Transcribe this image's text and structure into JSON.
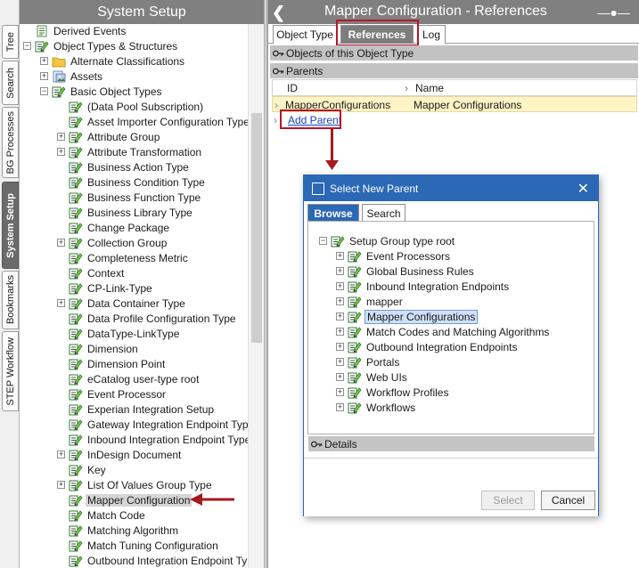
{
  "vertical_tabs": [
    "Tree",
    "Search",
    "BG Processes",
    "System Setup",
    "Bookmarks",
    "STEP Workflow"
  ],
  "left_panel": {
    "title": "System Setup",
    "tree": [
      {
        "label": "Derived Events",
        "expander": "none",
        "icon": "document-list-icon"
      },
      {
        "label": "Object Types & Structures",
        "expander": "minus",
        "icon": "object-type-icon"
      },
      {
        "label": "Alternate Classifications",
        "expander": "plus",
        "icon": "folder-icon"
      },
      {
        "label": "Assets",
        "expander": "plus",
        "icon": "asset-icon"
      },
      {
        "label": "Basic Object Types",
        "expander": "minus",
        "icon": "object-type-icon"
      },
      {
        "label": "(Data Pool Subscription)",
        "expander": "none",
        "icon": "object-type-icon"
      },
      {
        "label": "Asset Importer Configuration Type",
        "expander": "none",
        "icon": "object-type-icon"
      },
      {
        "label": "Attribute Group",
        "expander": "plus",
        "icon": "object-type-icon"
      },
      {
        "label": "Attribute Transformation",
        "expander": "plus",
        "icon": "object-type-icon"
      },
      {
        "label": "Business Action Type",
        "expander": "none",
        "icon": "object-type-icon"
      },
      {
        "label": "Business Condition Type",
        "expander": "none",
        "icon": "object-type-icon"
      },
      {
        "label": "Business Function Type",
        "expander": "none",
        "icon": "object-type-icon"
      },
      {
        "label": "Business Library Type",
        "expander": "none",
        "icon": "object-type-icon"
      },
      {
        "label": "Change Package",
        "expander": "none",
        "icon": "object-type-icon"
      },
      {
        "label": "Collection Group",
        "expander": "plus",
        "icon": "object-type-icon"
      },
      {
        "label": "Completeness Metric",
        "expander": "none",
        "icon": "object-type-icon"
      },
      {
        "label": "Context",
        "expander": "none",
        "icon": "object-type-icon"
      },
      {
        "label": "CP-Link-Type",
        "expander": "none",
        "icon": "object-type-icon"
      },
      {
        "label": "Data Container Type",
        "expander": "plus",
        "icon": "object-type-icon"
      },
      {
        "label": "Data Profile Configuration Type",
        "expander": "none",
        "icon": "object-type-icon"
      },
      {
        "label": "DataType-LinkType",
        "expander": "none",
        "icon": "object-type-icon"
      },
      {
        "label": "Dimension",
        "expander": "none",
        "icon": "object-type-icon"
      },
      {
        "label": "Dimension Point",
        "expander": "none",
        "icon": "object-type-icon"
      },
      {
        "label": "eCatalog user-type root",
        "expander": "none",
        "icon": "object-type-icon"
      },
      {
        "label": "Event Processor",
        "expander": "none",
        "icon": "object-type-icon"
      },
      {
        "label": "Experian Integration Setup",
        "expander": "none",
        "icon": "object-type-icon"
      },
      {
        "label": "Gateway Integration Endpoint Type",
        "expander": "none",
        "icon": "object-type-icon"
      },
      {
        "label": "Inbound Integration Endpoint Type",
        "expander": "none",
        "icon": "object-type-icon"
      },
      {
        "label": "InDesign Document",
        "expander": "plus",
        "icon": "object-type-icon"
      },
      {
        "label": "Key",
        "expander": "none",
        "icon": "object-type-icon"
      },
      {
        "label": "List Of Values Group Type",
        "expander": "plus",
        "icon": "object-type-icon"
      },
      {
        "label": "Mapper Configuration",
        "expander": "none",
        "icon": "object-type-icon",
        "selected": true
      },
      {
        "label": "Match Code",
        "expander": "none",
        "icon": "object-type-icon"
      },
      {
        "label": "Matching Algorithm",
        "expander": "none",
        "icon": "object-type-icon"
      },
      {
        "label": "Match Tuning Configuration",
        "expander": "none",
        "icon": "object-type-icon"
      },
      {
        "label": "Outbound Integration Endpoint Type",
        "expander": "none",
        "icon": "object-type-icon"
      }
    ]
  },
  "right_panel": {
    "title": "Mapper Configuration - References",
    "tabs": [
      "Object Type",
      "References",
      "Log"
    ],
    "active_tab": "References",
    "section_objects": "Objects of this  Object Type",
    "section_parents": "Parents",
    "table": {
      "columns": [
        "ID",
        "Name"
      ],
      "rows": [
        [
          "MapperConfigurations",
          "Mapper Configurations"
        ]
      ]
    },
    "add_parent_link": "Add Parent"
  },
  "dialog": {
    "title": "Select New Parent",
    "tabs": [
      "Browse",
      "Search"
    ],
    "active_tab": "Browse",
    "root": "Setup Group type root",
    "items": [
      {
        "label": "Event Processors"
      },
      {
        "label": "Global Business Rules"
      },
      {
        "label": "Inbound Integration Endpoints"
      },
      {
        "label": "mapper"
      },
      {
        "label": "Mapper Configurations",
        "selected": true
      },
      {
        "label": "Match Codes and Matching Algorithms"
      },
      {
        "label": "Outbound Integration Endpoints"
      },
      {
        "label": "Portals"
      },
      {
        "label": "Web UIs"
      },
      {
        "label": "Workflow Profiles"
      },
      {
        "label": "Workflows"
      }
    ],
    "details_label": "Details",
    "select_button": "Select",
    "cancel_button": "Cancel"
  },
  "colors": {
    "highlight": "#b5172b",
    "dialog_accent": "#2b68b5",
    "selected_row": "#fff4c6"
  }
}
